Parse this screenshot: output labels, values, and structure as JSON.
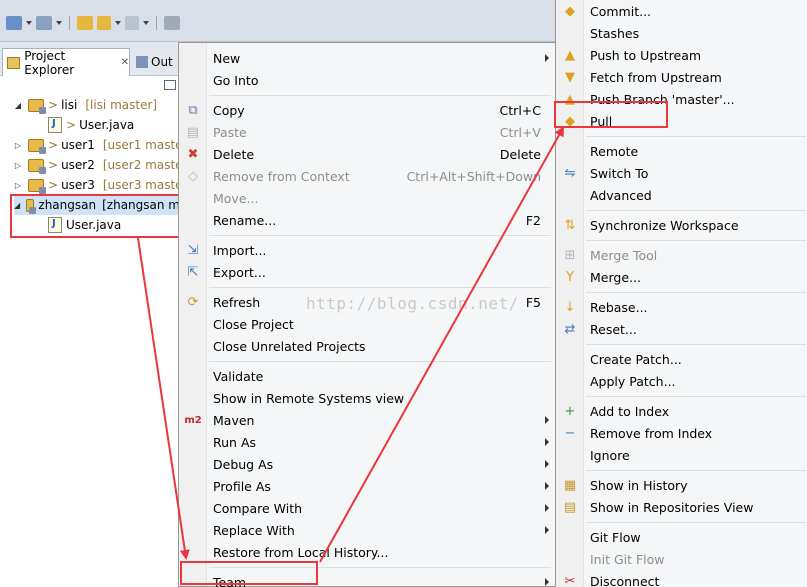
{
  "colors": {
    "highlight": "#e8373d",
    "repo_label": "#9a7a3a"
  },
  "toolbar": {
    "icons": [
      "new-wizard-icon",
      "save-icon",
      "print-icon",
      "run-icon",
      "debug-icon",
      "back-icon",
      "forward-icon",
      "external-tools-icon"
    ]
  },
  "explorer": {
    "tab_active": "Project Explorer",
    "tab_inactive": "Out",
    "tree": [
      {
        "prefix": "> ",
        "name": "lisi",
        "repo": "[lisi master]",
        "kind": "project",
        "expanded": true
      },
      {
        "prefix": "> ",
        "name": "User.java",
        "repo": "",
        "kind": "file"
      },
      {
        "prefix": "> ",
        "name": "user1",
        "repo": "[user1 maste",
        "kind": "project",
        "expanded": false
      },
      {
        "prefix": "> ",
        "name": "user2",
        "repo": "[user2 maste",
        "kind": "project",
        "expanded": false
      },
      {
        "prefix": "> ",
        "name": "user3",
        "repo": "[user3 maste",
        "kind": "project",
        "expanded": false
      },
      {
        "prefix": "",
        "name": "zhangsan",
        "repo": "[zhangsan m",
        "kind": "project",
        "expanded": true
      },
      {
        "prefix": "",
        "name": "User.java",
        "repo": "",
        "kind": "file"
      }
    ]
  },
  "menu1": [
    {
      "label": "New",
      "shortcut": "",
      "submenu": true,
      "icon": "",
      "disabled": false
    },
    {
      "label": "Go Into",
      "shortcut": "",
      "submenu": false,
      "icon": "",
      "disabled": false
    },
    {
      "sep": true
    },
    {
      "label": "Copy",
      "shortcut": "Ctrl+C",
      "submenu": false,
      "icon": "copy-icon",
      "disabled": false
    },
    {
      "label": "Paste",
      "shortcut": "Ctrl+V",
      "submenu": false,
      "icon": "paste-icon",
      "disabled": true
    },
    {
      "label": "Delete",
      "shortcut": "Delete",
      "submenu": false,
      "icon": "delete-icon",
      "disabled": false
    },
    {
      "label": "Remove from Context",
      "shortcut": "Ctrl+Alt+Shift+Down",
      "submenu": false,
      "icon": "remove-context-icon",
      "disabled": true
    },
    {
      "label": "Move...",
      "shortcut": "",
      "submenu": false,
      "icon": "",
      "disabled": true
    },
    {
      "label": "Rename...",
      "shortcut": "F2",
      "submenu": false,
      "icon": "",
      "disabled": false
    },
    {
      "sep": true
    },
    {
      "label": "Import...",
      "shortcut": "",
      "submenu": false,
      "icon": "import-icon",
      "disabled": false
    },
    {
      "label": "Export...",
      "shortcut": "",
      "submenu": false,
      "icon": "export-icon",
      "disabled": false
    },
    {
      "sep": true
    },
    {
      "label": "Refresh",
      "shortcut": "F5",
      "submenu": false,
      "icon": "refresh-icon",
      "disabled": false
    },
    {
      "label": "Close Project",
      "shortcut": "",
      "submenu": false,
      "icon": "",
      "disabled": false
    },
    {
      "label": "Close Unrelated Projects",
      "shortcut": "",
      "submenu": false,
      "icon": "",
      "disabled": false
    },
    {
      "sep": true
    },
    {
      "label": "Validate",
      "shortcut": "",
      "submenu": false,
      "icon": "",
      "disabled": false
    },
    {
      "label": "Show in Remote Systems view",
      "shortcut": "",
      "submenu": false,
      "icon": "",
      "disabled": false
    },
    {
      "label": "Maven",
      "shortcut": "",
      "submenu": true,
      "icon": "maven-icon",
      "disabled": false
    },
    {
      "label": "Run As",
      "shortcut": "",
      "submenu": true,
      "icon": "",
      "disabled": false
    },
    {
      "label": "Debug As",
      "shortcut": "",
      "submenu": true,
      "icon": "",
      "disabled": false
    },
    {
      "label": "Profile As",
      "shortcut": "",
      "submenu": true,
      "icon": "",
      "disabled": false
    },
    {
      "label": "Compare With",
      "shortcut": "",
      "submenu": true,
      "icon": "",
      "disabled": false
    },
    {
      "label": "Replace With",
      "shortcut": "",
      "submenu": true,
      "icon": "",
      "disabled": false
    },
    {
      "label": "Restore from Local History...",
      "shortcut": "",
      "submenu": false,
      "icon": "",
      "disabled": false
    },
    {
      "sep": true
    },
    {
      "label": "Team",
      "shortcut": "",
      "submenu": true,
      "icon": "",
      "disabled": false
    }
  ],
  "menu2": [
    {
      "label": "Commit...",
      "shortcut": "Ctrl+",
      "icon": "commit-icon",
      "disabled": false
    },
    {
      "label": "Stashes",
      "shortcut": "",
      "icon": "",
      "disabled": false
    },
    {
      "label": "Push to Upstream",
      "shortcut": "",
      "icon": "push-icon",
      "disabled": false
    },
    {
      "label": "Fetch from Upstream",
      "shortcut": "",
      "icon": "fetch-icon",
      "disabled": false
    },
    {
      "label": "Push Branch 'master'...",
      "shortcut": "",
      "icon": "push-branch-icon",
      "disabled": false
    },
    {
      "label": "Pull",
      "shortcut": "",
      "icon": "pull-icon",
      "disabled": false
    },
    {
      "sep": true
    },
    {
      "label": "Remote",
      "shortcut": "",
      "icon": "",
      "disabled": false
    },
    {
      "label": "Switch To",
      "shortcut": "",
      "icon": "switch-icon",
      "disabled": false
    },
    {
      "label": "Advanced",
      "shortcut": "",
      "icon": "",
      "disabled": false
    },
    {
      "sep": true
    },
    {
      "label": "Synchronize Workspace",
      "shortcut": "",
      "icon": "synchronize-icon",
      "disabled": false
    },
    {
      "sep": true
    },
    {
      "label": "Merge Tool",
      "shortcut": "",
      "icon": "merge-tool-icon",
      "disabled": true
    },
    {
      "label": "Merge...",
      "shortcut": "",
      "icon": "merge-icon",
      "disabled": false
    },
    {
      "sep": true
    },
    {
      "label": "Rebase...",
      "shortcut": "",
      "icon": "rebase-icon",
      "disabled": false
    },
    {
      "label": "Reset...",
      "shortcut": "",
      "icon": "reset-icon",
      "disabled": false
    },
    {
      "sep": true
    },
    {
      "label": "Create Patch...",
      "shortcut": "",
      "icon": "",
      "disabled": false
    },
    {
      "label": "Apply Patch...",
      "shortcut": "",
      "icon": "",
      "disabled": false
    },
    {
      "sep": true
    },
    {
      "label": "Add to Index",
      "shortcut": "",
      "icon": "add-index-icon",
      "disabled": false
    },
    {
      "label": "Remove from Index",
      "shortcut": "",
      "icon": "remove-index-icon",
      "disabled": false
    },
    {
      "label": "Ignore",
      "shortcut": "",
      "icon": "",
      "disabled": false
    },
    {
      "sep": true
    },
    {
      "label": "Show in History",
      "shortcut": "",
      "icon": "history-icon",
      "disabled": false
    },
    {
      "label": "Show in Repositories View",
      "shortcut": "",
      "icon": "repositories-icon",
      "disabled": false
    },
    {
      "sep": true
    },
    {
      "label": "Git Flow",
      "shortcut": "",
      "icon": "",
      "disabled": false
    },
    {
      "label": "Init Git Flow",
      "shortcut": "",
      "icon": "",
      "disabled": true
    },
    {
      "label": "Disconnect",
      "shortcut": "",
      "icon": "disconnect-icon",
      "disabled": false
    }
  ],
  "watermark": "http://blog.csdn.net/"
}
